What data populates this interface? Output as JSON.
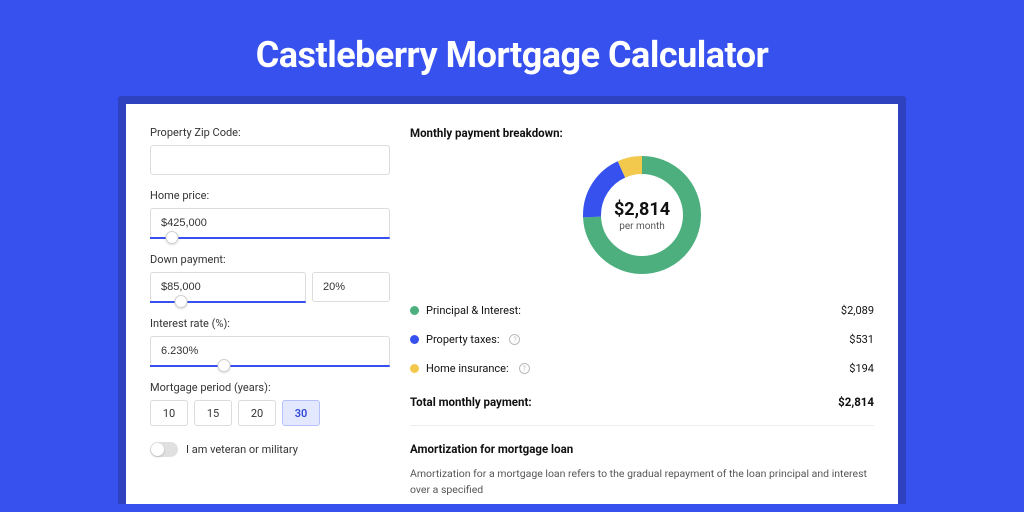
{
  "page_title": "Castleberry Mortgage Calculator",
  "form": {
    "zip_label": "Property Zip Code:",
    "zip_value": "",
    "home_price_label": "Home price:",
    "home_price_value": "$425,000",
    "home_price_slider_pct": 9,
    "down_payment_label": "Down payment:",
    "down_payment_value": "$85,000",
    "down_payment_pct_value": "20%",
    "down_payment_slider_pct": 20,
    "interest_label": "Interest rate (%):",
    "interest_value": "6.230%",
    "interest_slider_pct": 31,
    "period_label": "Mortgage period (years):",
    "period_options": [
      "10",
      "15",
      "20",
      "30"
    ],
    "period_selected": "30",
    "veteran_label": "I am veteran or military"
  },
  "breakdown": {
    "title": "Monthly payment breakdown:",
    "center_amount": "$2,814",
    "center_sub": "per month",
    "items": [
      {
        "label": "Principal & Interest:",
        "value": "$2,089",
        "color": "green",
        "info": false
      },
      {
        "label": "Property taxes:",
        "value": "$531",
        "color": "blue",
        "info": true
      },
      {
        "label": "Home insurance:",
        "value": "$194",
        "color": "yellow",
        "info": true
      }
    ],
    "total_label": "Total monthly payment:",
    "total_value": "$2,814"
  },
  "amortization": {
    "title": "Amortization for mortgage loan",
    "text": "Amortization for a mortgage loan refers to the gradual repayment of the loan principal and interest over a specified"
  },
  "chart_data": {
    "type": "pie",
    "title": "Monthly payment breakdown",
    "series": [
      {
        "name": "Principal & Interest",
        "value": 2089,
        "color": "#4caf7d"
      },
      {
        "name": "Property taxes",
        "value": 531,
        "color": "#3751ef"
      },
      {
        "name": "Home insurance",
        "value": 194,
        "color": "#f2c94c"
      }
    ],
    "total": 2814,
    "center_label": "$2,814 per month"
  }
}
